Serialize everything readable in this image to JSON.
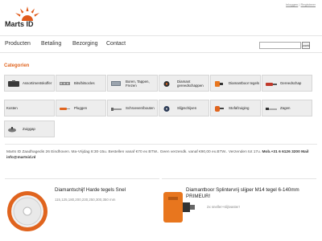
{
  "header": {
    "logo_text": "Marts ID",
    "links": {
      "login": "inloggen",
      "separator": "|",
      "register": "Registreer"
    }
  },
  "nav": {
    "items": [
      "Producten",
      "Betaling",
      "Bezorging",
      "Contact"
    ],
    "search_placeholder": "",
    "search_button": "zoek"
  },
  "categories": {
    "title": "Categorien",
    "items": [
      {
        "label": "Assortimentskoffer",
        "icon": "case-icon"
      },
      {
        "label": "Bits/bitsocles",
        "icon": "bits-icon"
      },
      {
        "label": "Boren, Tappen, Frezen",
        "icon": "drill-bit-icon"
      },
      {
        "label": "Diamant gereedschappen",
        "icon": "diamond-tool-icon"
      },
      {
        "label": "Diamantboor tegels",
        "icon": "core-drill-icon"
      },
      {
        "label": "Gereedschap",
        "icon": "tool-icon"
      },
      {
        "label": "Kosten",
        "icon": ""
      },
      {
        "label": "Pluggen",
        "icon": "plug-icon"
      },
      {
        "label": "Schroeven/bouten",
        "icon": "screw-icon"
      },
      {
        "label": "Slijpschijven",
        "icon": "grinding-disc-icon"
      },
      {
        "label": "Stofafzuiging",
        "icon": "dust-extraction-icon"
      },
      {
        "label": "Zagen",
        "icon": "saw-icon"
      },
      {
        "label": "Zuiggap",
        "icon": "suction-icon"
      }
    ]
  },
  "info": {
    "line": "Bestellen vanaf €70 ex BTW.. Geen verzendk. vanaf €90,00 ex.BTW.. Verzenden tot 17u.",
    "prefix": "Marts ID Zaadhagedis 26 Eindhoven. Ma-Vrijdag 8:30-15u.",
    "mob_label": "Mob.+31 6 6126 3200 Mail",
    "email": "info@martsid.nl"
  },
  "products": [
    {
      "title": "Diamantschijf Harde tegels Snel",
      "text": "115,125,180,200,230,250,300,350 mm",
      "accent": "#e0641e"
    },
    {
      "title": "Diamantboor Splintervrij slijper M14 tegel 6-140mm PRIMEUR!",
      "text": "2x sneller+slijtvaster!",
      "accent": "#e8761e"
    }
  ],
  "colors": {
    "accent": "#e0641e",
    "tile_bg": "#ededed"
  }
}
